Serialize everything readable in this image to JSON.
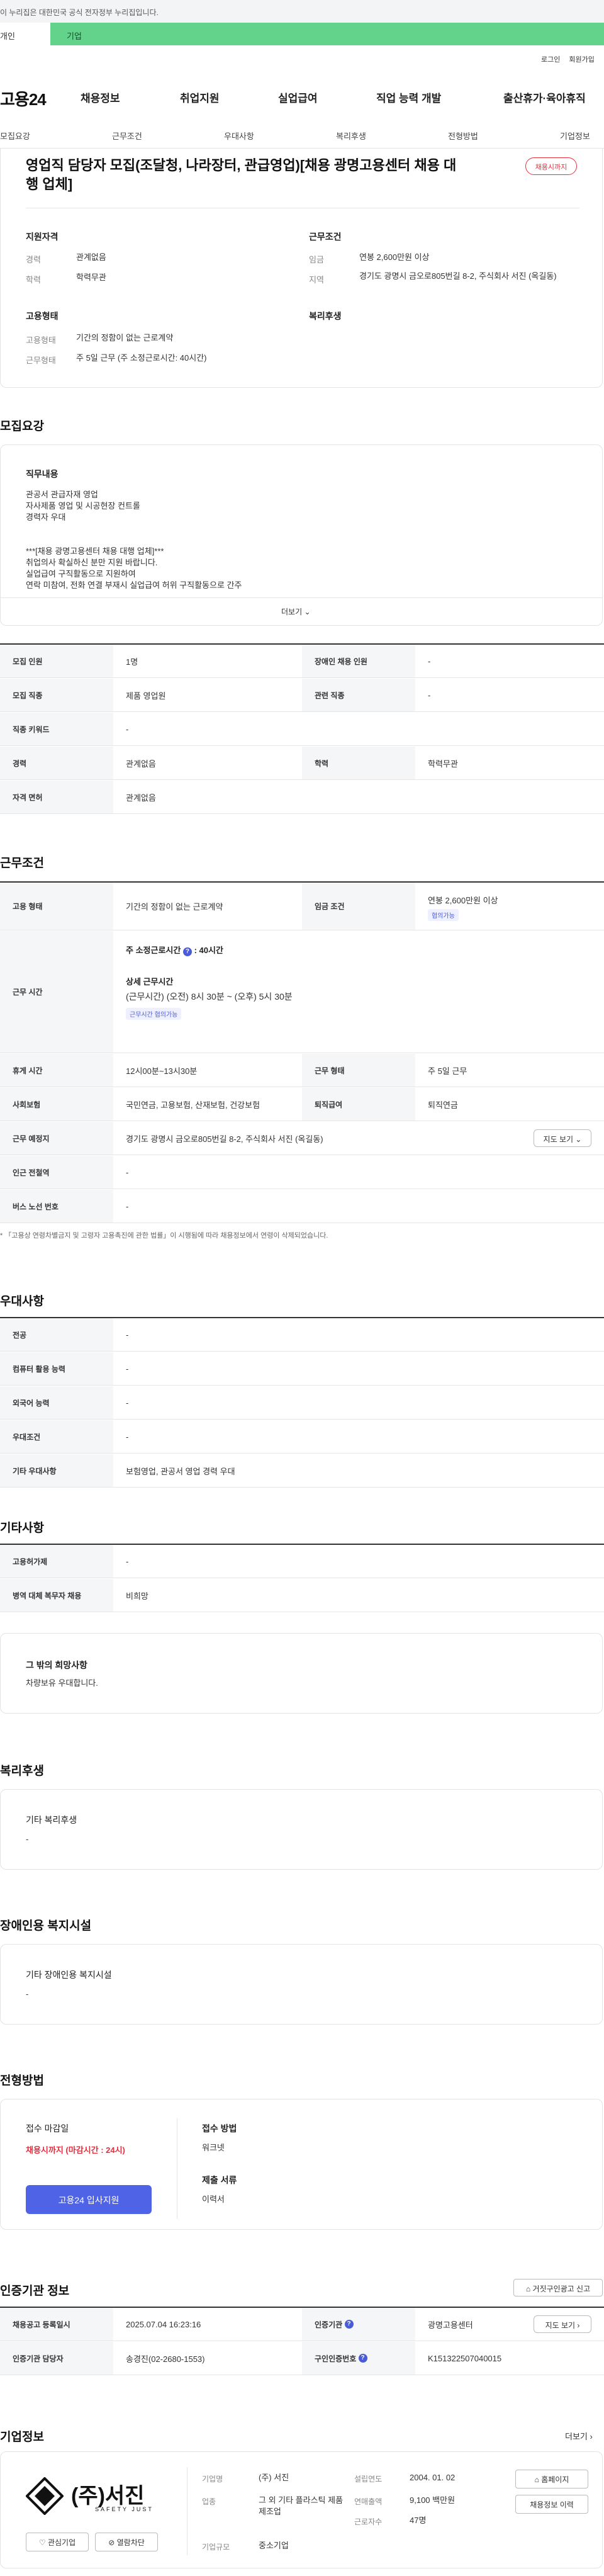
{
  "banner": {
    "text": "이 누리집은 대한민국 공식 전자정부 누리집입니다.",
    "tab_individual": "개인",
    "tab_company": "기업"
  },
  "util": {
    "login": "로그인",
    "signup": "회원가입"
  },
  "gnb": {
    "logo": "고용24",
    "items": [
      "채용정보",
      "취업지원",
      "실업급여",
      "직업 능력 개발",
      "출산휴가·육아휴직"
    ]
  },
  "subnav": [
    "모집요강",
    "근무조건",
    "우대사항",
    "복리후생",
    "전형방법",
    "기업정보"
  ],
  "job": {
    "title": "영업직 담당자 모집(조달청, 나라장터, 관급영업)[채용 광명고용센터 채용 대행 업체]",
    "status": "채용시까지",
    "qual_heading": "지원자격",
    "cond_heading": "근무조건",
    "career_label": "경력",
    "career": "관계없음",
    "edu_label": "학력",
    "edu": "학력무관",
    "wage_label": "임금",
    "wage": "연봉 2,600만원 이상",
    "region_label": "지역",
    "region": "경기도 광명시 금오로805번길 8-2, 주식회사 서진 (옥길동)",
    "emptype_heading": "고용형태",
    "welfare_heading": "복리후생",
    "emptype_label": "고용형태",
    "emptype": "기간의 정함이 없는 근로계약",
    "worktype_label": "근무형태",
    "worktype": "주 5일 근무 (주 소정근로시간: 40시간)"
  },
  "recruit": {
    "heading": "모집요강",
    "duties_heading": "직무내용",
    "duties": [
      "관공서 관급자재 영업",
      "자사제품 영업 및 시공현장 컨트롤",
      "경력자 우대",
      "",
      "***[채용 광명고용센터 채용 대행 업체]***",
      "취업의사 확실하신 분만 지원 바랍니다.",
      "실업급여 구직활동으로 지원하여",
      "연락 미참여, 전화 연결 부재시 실업급여 허위 구직활동으로 간주"
    ],
    "more": "더보기",
    "rows": [
      {
        "h1": "모집 인원",
        "v1": "1명",
        "h2": "장애인 채용 인원",
        "v2": "-"
      },
      {
        "h1": "모집 직종",
        "v1": "제품 영업원",
        "h2": "관련 직종",
        "v2": "-"
      },
      {
        "h1": "직종 키워드",
        "v1": "-"
      },
      {
        "h1": "경력",
        "v1": "관계없음",
        "h2": "학력",
        "v2": "학력무관"
      },
      {
        "h1": "자격 면허",
        "v1": "관계없음"
      }
    ]
  },
  "conditions": {
    "heading": "근무조건",
    "emptype_h": "고용 형태",
    "emptype": "기간의 정함이 없는 근로계약",
    "wage_h": "임금 조건",
    "wage": "연봉 2,600만원 이상",
    "wage_badge": "협의가능",
    "worktime_h": "근무 시간",
    "weekly": "주 소정근로시간",
    "weekly_val": ": 40시간",
    "detail_h": "상세 근무시간",
    "detail": "(근무시간) (오전) 8시 30분 ~ (오후) 5시 30분",
    "detail_badge": "근무시간 협의가능",
    "rows": [
      {
        "h1": "휴게 시간",
        "v1": "12시00분~13시30분",
        "h2": "근무 형태",
        "v2": "주 5일 근무"
      },
      {
        "h1": "사회보험",
        "v1": "국민연금, 고용보험, 산재보험, 건강보험",
        "h2": "퇴직급여",
        "v2": "퇴직연금"
      },
      {
        "h1": "근무 예정지",
        "v1": "경기도 광명시 금오로805번길 8-2, 주식회사 서진 (옥길동)",
        "btn": "지도 보기"
      },
      {
        "h1": "인근 전철역",
        "v1": "-"
      },
      {
        "h1": "버스 노선 번호",
        "v1": "-"
      }
    ],
    "note": "* 「고용상 연령차별금지 및 고령자 고용촉진에 관한 법률」이 시행됨에 따라 채용정보에서 연령이 삭제되었습니다."
  },
  "prefer": {
    "heading": "우대사항",
    "rows": [
      {
        "h": "전공",
        "v": "-"
      },
      {
        "h": "컴퓨터 활용 능력",
        "v": "-"
      },
      {
        "h": "외국어 능력",
        "v": "-"
      },
      {
        "h": "우대조건",
        "v": "-"
      },
      {
        "h": "기타 우대사항",
        "v": "보험영업, 관공서 영업 경력 우대"
      }
    ]
  },
  "etc": {
    "heading": "기타사항",
    "rows": [
      {
        "h": "고용허가제",
        "v": "-"
      },
      {
        "h": "병역 대체 복무자 채용",
        "v": "비희망"
      }
    ],
    "other_h": "그 밖의 희망사항",
    "other": "차량보유 우대합니다."
  },
  "welfare": {
    "heading": "복리후생",
    "box_h": "기타 복리후생",
    "box_v": "-"
  },
  "disability": {
    "heading": "장애인용 복지시설",
    "box_h": "기타 장애인용 복지시설",
    "box_v": "-"
  },
  "process": {
    "heading": "전형방법",
    "deadline_h": "접수 마감일",
    "deadline": "채용시까지 (마감시간 : 24시)",
    "method_h": "접수 방법",
    "method": "워크넷",
    "docs_h": "제출 서류",
    "docs": "이력서",
    "apply": "고용24 입사지원"
  },
  "cert": {
    "heading": "인증기관 정보",
    "report": "거짓구인광고 신고",
    "rows": [
      {
        "h1": "채용공고 등록일시",
        "v1": "2025.07.04 16:23:16",
        "h2": "인증기관",
        "v2": "광명고용센터",
        "btn": "지도 보기"
      },
      {
        "h1": "인증기관 담당자",
        "v1": "송경진(02-2680-1553)",
        "h2": "구인인증번호",
        "v2": "K151322507040015"
      }
    ]
  },
  "company": {
    "heading": "기업정보",
    "more": "더보기",
    "name": "(주)서진",
    "sub": "SAFETY JUST",
    "fav": "관심기업",
    "block": "열람차단",
    "labels": {
      "name": "기업명",
      "industry": "업종",
      "size": "기업규모",
      "founded": "설립연도",
      "sales": "연매출액",
      "employees": "근로자수"
    },
    "values": {
      "name": "(주) 서진",
      "industry": "그 외 기타 플라스틱 제품 제조업",
      "size": "중소기업",
      "founded": "2004. 01. 02",
      "sales": "9,100 백만원",
      "employees": "47명"
    },
    "homepage": "홈페이지",
    "history": "채용정보 이력"
  }
}
